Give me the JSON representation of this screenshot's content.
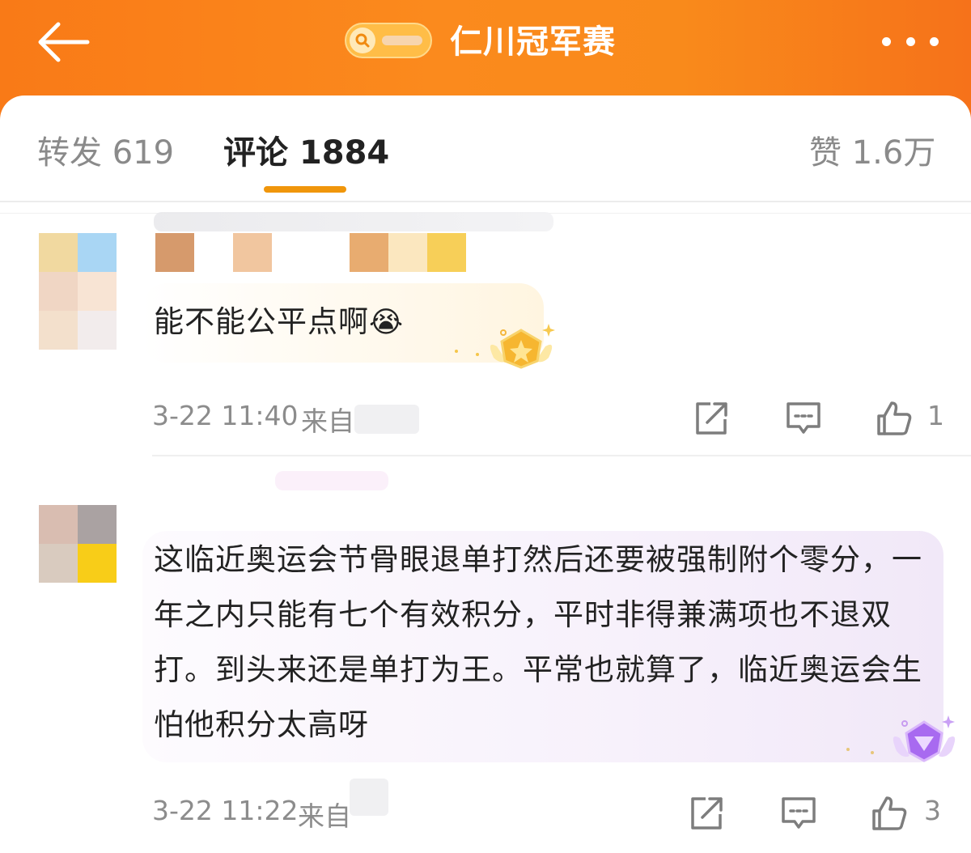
{
  "header": {
    "topic_title": "仁川冠军赛",
    "back_icon": "arrow-left-icon",
    "more_icon": "more-dots-icon",
    "search_icon": "search-icon"
  },
  "tabs": [
    {
      "label": "转发",
      "count": "619",
      "active": false
    },
    {
      "label": "评论",
      "count": "1884",
      "active": true
    },
    {
      "label": "赞",
      "count": "1.6万",
      "active": false
    }
  ],
  "colors": {
    "header_orange": "#f97a17",
    "tab_underline": "#f0960b",
    "muted_text": "#8c8c8c"
  },
  "comments": [
    {
      "text": "能不能公平点啊",
      "emoji": "😭",
      "timestamp": "3-22 11:40",
      "from_label": "来自",
      "likes": "1"
    },
    {
      "text": "这临近奥运会节骨眼退单打然后还要被强制附个零分，一年之内只能有七个有效积分，平时非得兼满项也不退双打。到头来还是单打为王。平常也就算了，临近奥运会生怕他积分太高呀",
      "timestamp": "3-22 11:22",
      "from_label": "来自",
      "likes": "3"
    }
  ]
}
